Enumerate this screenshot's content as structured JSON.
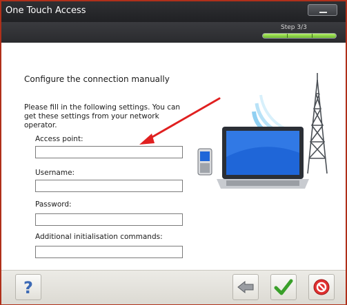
{
  "window": {
    "title": "One Touch Access"
  },
  "wizard": {
    "step_label": "Step 3/3",
    "progress": 1.0,
    "segments": 3
  },
  "page": {
    "heading": "Configure the connection manually",
    "intro": "Please fill in the following settings. You can get these settings from your network operator."
  },
  "fields": {
    "access_point": {
      "label": "Access point:",
      "value": ""
    },
    "username": {
      "label": "Username:",
      "value": ""
    },
    "password": {
      "label": "Password:",
      "value": ""
    },
    "init_commands": {
      "label": "Additional initialisation commands:",
      "value": ""
    }
  },
  "icons": {
    "minimize": "minimize-icon",
    "help": "question-mark-icon",
    "back": "back-arrow-icon",
    "confirm": "checkmark-icon",
    "cancel": "cancel-icon"
  },
  "colors": {
    "accent_border": "#b0301a",
    "progress_green": "#6ab82a",
    "arrow_red": "#e02020",
    "laptop_screen": "#1f66d8"
  }
}
